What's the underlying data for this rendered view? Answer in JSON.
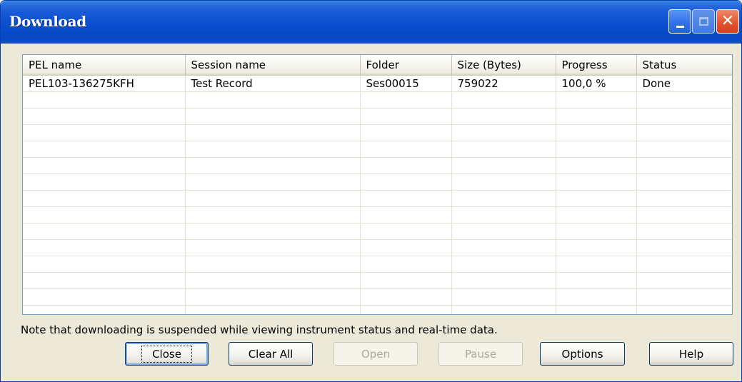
{
  "window": {
    "title": "Download",
    "buttons": {
      "minimize": "minimize-icon",
      "maximize": "maximize-icon",
      "close": "close-icon"
    }
  },
  "table": {
    "columns": [
      "PEL name",
      "Session name",
      "Folder",
      "Size (Bytes)",
      "Progress",
      "Status"
    ],
    "rows": [
      [
        "PEL103-136275KFH",
        "Test Record",
        "Ses00015",
        "759022",
        "100,0 %",
        "Done"
      ]
    ]
  },
  "note": "Note that downloading is suspended while viewing instrument status and real-time data.",
  "actions": {
    "close": "Close",
    "clear_all": "Clear All",
    "open": "Open",
    "pause": "Pause",
    "options": "Options",
    "help": "Help"
  },
  "colors": {
    "titlebar": "#0a4fd0",
    "window_face": "#ece9d8",
    "close_button": "#e2512d"
  }
}
